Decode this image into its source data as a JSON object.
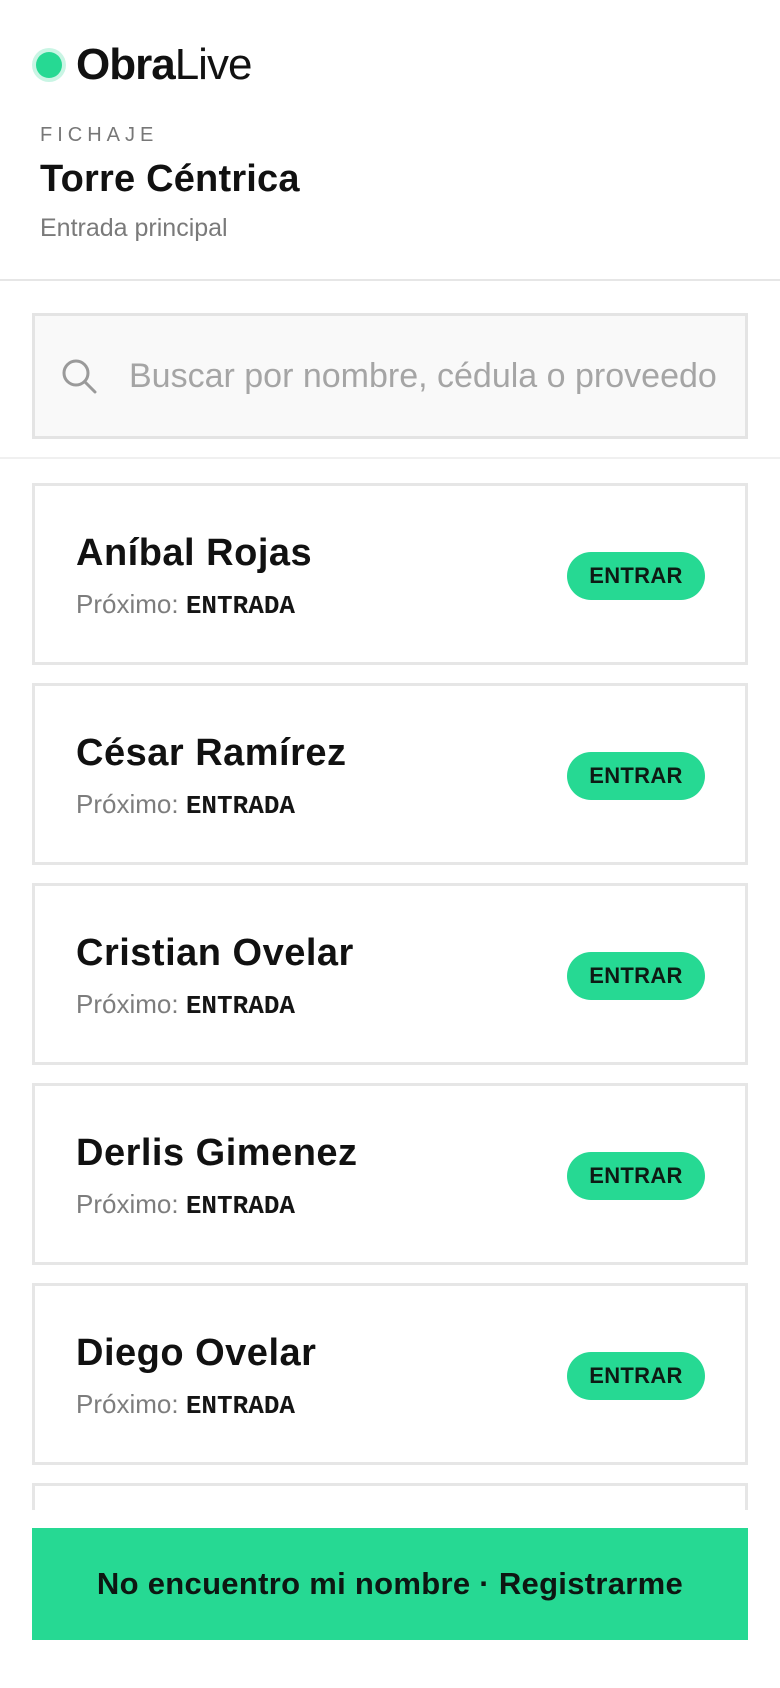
{
  "brand": {
    "name_strong": "Obra",
    "name_light": "Live",
    "accent_color": "#26d993"
  },
  "header": {
    "eyebrow": "FICHAJE",
    "site_title": "Torre Céntrica",
    "site_subtitle": "Entrada principal"
  },
  "search": {
    "icon": "search-icon",
    "placeholder": "Buscar por nombre, cédula o proveedor",
    "value": ""
  },
  "workers": [
    {
      "name": "Aníbal Rojas",
      "next_label": "Próximo:",
      "next_value": "ENTRADA",
      "action": "ENTRAR"
    },
    {
      "name": "César Ramírez",
      "next_label": "Próximo:",
      "next_value": "ENTRADA",
      "action": "ENTRAR"
    },
    {
      "name": "Cristian Ovelar",
      "next_label": "Próximo:",
      "next_value": "ENTRADA",
      "action": "ENTRAR"
    },
    {
      "name": "Derlis Gimenez",
      "next_label": "Próximo:",
      "next_value": "ENTRADA",
      "action": "ENTRAR"
    },
    {
      "name": "Diego Ovelar",
      "next_label": "Próximo:",
      "next_value": "ENTRADA",
      "action": "ENTRAR"
    },
    {
      "name": "",
      "next_label": "",
      "next_value": "",
      "action": ""
    }
  ],
  "footer": {
    "register_label": "No encuentro mi nombre · Registrarme"
  }
}
